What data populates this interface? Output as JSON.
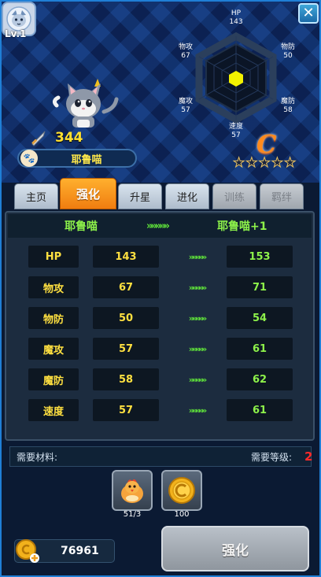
{
  "header": {
    "level": "Lv.1",
    "close_glyph": "✕"
  },
  "radar": {
    "labels": [
      "HP",
      "物防",
      "魔防",
      "速度",
      "魔攻",
      "物攻"
    ],
    "values": [
      "143",
      "50",
      "58",
      "57",
      "57",
      "67"
    ],
    "fill_color": "#f2f200"
  },
  "hero": {
    "power": "344",
    "name": "耶鲁喵",
    "rank": "C",
    "stars": 5
  },
  "tabs": [
    {
      "label": "主页"
    },
    {
      "label": "强化"
    },
    {
      "label": "升星"
    },
    {
      "label": "进化"
    },
    {
      "label": "训练"
    },
    {
      "label": "羁绊"
    }
  ],
  "upgrade": {
    "from_name": "耶鲁喵",
    "arrows": "»»»»»",
    "to_name": "耶鲁喵+1",
    "stats": [
      {
        "label": "HP",
        "old": "143",
        "new": "153"
      },
      {
        "label": "物攻",
        "old": "67",
        "new": "71"
      },
      {
        "label": "物防",
        "old": "50",
        "new": "54"
      },
      {
        "label": "魔攻",
        "old": "57",
        "new": "61"
      },
      {
        "label": "魔防",
        "old": "58",
        "new": "62"
      },
      {
        "label": "速度",
        "old": "57",
        "new": "61"
      }
    ]
  },
  "materials": {
    "label": "需要材料:",
    "level_label": "需要等级:",
    "level_value": "2",
    "items": [
      {
        "icon": "chicken-icon",
        "count": "51/3"
      },
      {
        "icon": "coin-icon",
        "count": "100"
      }
    ]
  },
  "footer": {
    "gold": "76961",
    "button_label": "强化"
  },
  "colors": {
    "accent_orange": "#f07d10",
    "stat_yellow": "#ffe040",
    "stat_green": "#8df24a",
    "warning_red": "#ff2a2a"
  }
}
